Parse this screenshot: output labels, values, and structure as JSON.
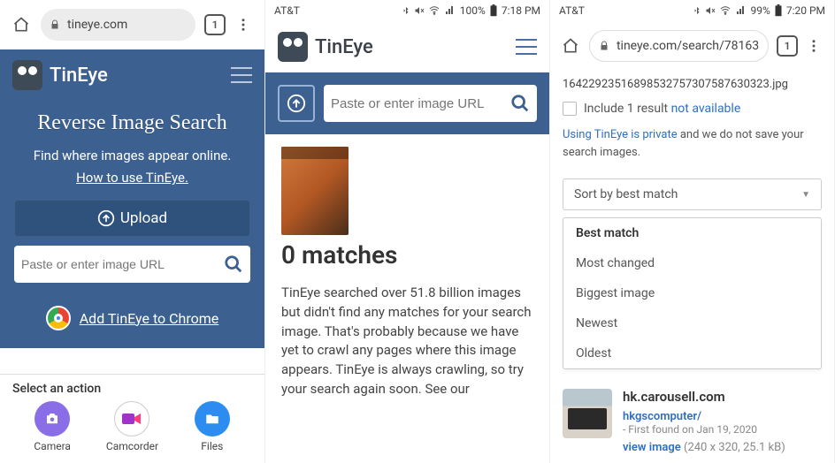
{
  "col1": {
    "chrome": {
      "address": "tineye.com",
      "tab_count": "1"
    },
    "brand": "TinEye",
    "hero_title": "Reverse Image Search",
    "hero_sub": "Find where images appear online.",
    "hero_howto": "How to use TinEye.",
    "upload_label": "Upload",
    "url_placeholder": "Paste or enter image URL",
    "chrome_promo": "Add TinEye to Chrome",
    "sheet_title": "Select an action",
    "actions": {
      "camera": "Camera",
      "camcorder": "Camcorder",
      "files": "Files"
    }
  },
  "col2": {
    "status": {
      "carrier": "AT&T",
      "battery": "100%",
      "time": "7:18 PM"
    },
    "brand": "TinEye",
    "url_placeholder": "Paste or enter image URL",
    "matches_heading": "0 matches",
    "body_text": "TinEye searched over 51.8 billion images but didn't find any matches for your search image. That's probably because we have yet to crawl any pages where this image appears. TinEye is always crawling, so try your search again soon. See our"
  },
  "col3": {
    "status": {
      "carrier": "AT&T",
      "battery": "99%",
      "time": "7:20 PM"
    },
    "chrome": {
      "address": "tineye.com/search/78163",
      "tab_count": "1"
    },
    "filename": "16422923516898532757307587630323.jpg",
    "include_pre": "Include 1 result ",
    "include_na": "not available",
    "privacy_link": "Using TinEye is private",
    "privacy_rest": " and we do not save your search images.",
    "sort_current": "Sort by best match",
    "sort_options": [
      "Best match",
      "Most changed",
      "Biggest image",
      "Newest",
      "Oldest"
    ],
    "result": {
      "domain": "hk.carousell.com",
      "user": "hkgscomputer/",
      "found_pre": "- First found on ",
      "found_date": "Jan 19, 2020",
      "view_label": "view image",
      "dims": " (240 x 320, 25.1 kB)"
    }
  }
}
